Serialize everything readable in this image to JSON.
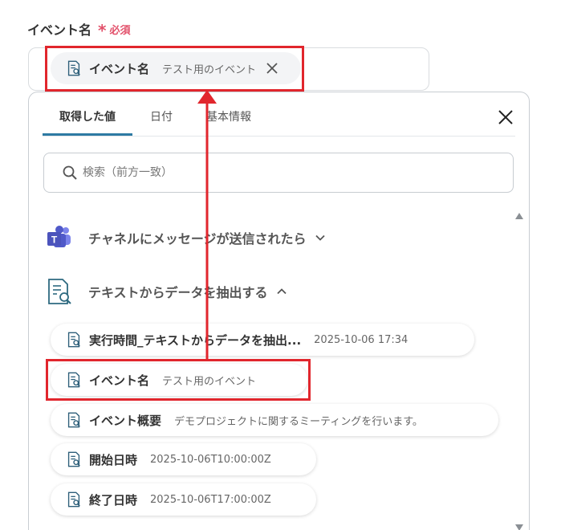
{
  "field": {
    "label": "イベント名",
    "required_mark": "*",
    "required_text": "必須",
    "selected": {
      "key": "イベント名",
      "value": "テスト用のイベント"
    }
  },
  "panel": {
    "tabs": [
      "取得した値",
      "日付",
      "基本情報"
    ],
    "search_placeholder": "検索（前方一致）",
    "sections": [
      {
        "title": "チャネルにメッセージが送信されたら",
        "icon": "teams-icon",
        "expanded": false
      },
      {
        "title": "テキストからデータを抽出する",
        "icon": "document-search-icon",
        "expanded": true
      }
    ],
    "items": [
      {
        "key": "実行時間_テキストからデータを抽出...",
        "value": "2025-10-06 17:34"
      },
      {
        "key": "イベント名",
        "value": "テスト用のイベント"
      },
      {
        "key": "イベント概要",
        "value": "デモプロジェクトに関するミーティングを行います。"
      },
      {
        "key": "開始日時",
        "value": "2025-10-06T10:00:00Z"
      },
      {
        "key": "終了日時",
        "value": "2025-10-06T17:00:00Z"
      }
    ]
  },
  "colors": {
    "accent": "#2e7aa3",
    "required": "#e2506a",
    "highlight": "#e1262d"
  }
}
